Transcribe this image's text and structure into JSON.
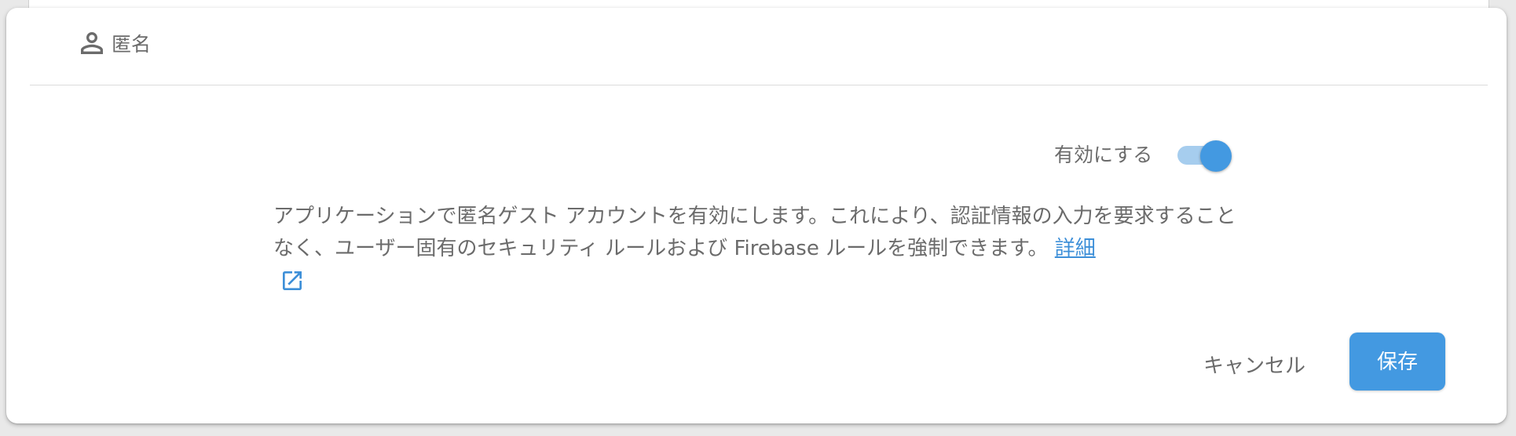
{
  "provider": {
    "icon": "person-outline-icon",
    "title": "匿名"
  },
  "toggle": {
    "label": "有効にする",
    "state": "on",
    "color": "#4399e1"
  },
  "description": {
    "text": "アプリケーションで匿名ゲスト アカウントを有効にします。これにより、認証情報の入力を要求することなく、ユーザー固有のセキュリティ ルールおよび Firebase ルールを強制できます。",
    "link_label": "詳細",
    "link_icon": "open-in-new-icon"
  },
  "actions": {
    "cancel_label": "キャンセル",
    "save_label": "保存"
  },
  "colors": {
    "accent": "#4399e1",
    "link": "#3d8fd8",
    "text_secondary": "#6b6b6b"
  }
}
